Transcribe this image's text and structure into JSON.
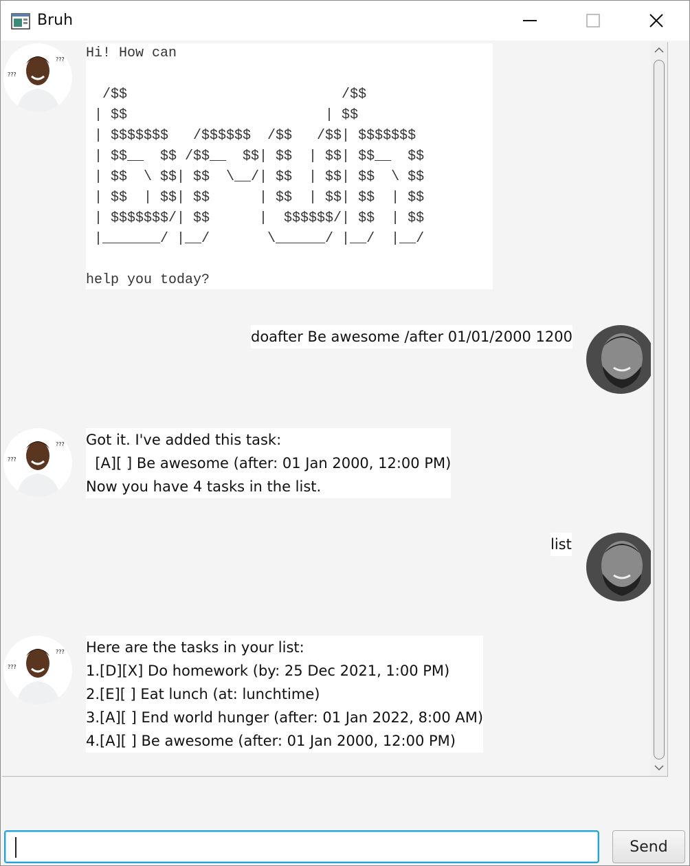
{
  "window": {
    "title": "Bruh",
    "controls": [
      "minimize",
      "maximize",
      "close"
    ]
  },
  "messages": [
    {
      "sender": "bot",
      "style": "mono",
      "text": "Hi! How can\n\n  /$$                          /$$\n | $$                        | $$\n | $$$$$$$   /$$$$$$  /$$   /$$| $$$$$$$\n | $$__  $$ /$$__  $$| $$  | $$| $$__  $$\n | $$  \\ $$| $$  \\__/| $$  | $$| $$  \\ $$\n | $$  | $$| $$      | $$  | $$| $$  | $$\n | $$$$$$$/| $$      |  $$$$$$/| $$  | $$\n |_______/ |__/       \\______/ |__/  |__/\n\nhelp you today?"
    },
    {
      "sender": "user",
      "style": "sans",
      "text": "doafter Be awesome /after 01/01/2000 1200"
    },
    {
      "sender": "bot",
      "style": "sans",
      "text": "Got it. I've added this task:\n  [A][ ] Be awesome (after: 01 Jan 2000, 12:00 PM)\nNow you have 4 tasks in the list."
    },
    {
      "sender": "user",
      "style": "sans",
      "text": "list"
    },
    {
      "sender": "bot",
      "style": "sans",
      "text": "Here are the tasks in your list:\n1.[D][X] Do homework (by: 25 Dec 2021, 1:00 PM)\n2.[E][ ] Eat lunch (at: lunchtime)\n3.[A][ ] End world hunger (after: 01 Jan 2022, 8:00 AM)\n4.[A][ ] Be awesome (after: 01 Jan 2000, 12:00 PM)"
    }
  ],
  "avatar_labels": {
    "bot": "???",
    "bot_small": "???"
  },
  "input": {
    "value": "",
    "placeholder": ""
  },
  "send_button": {
    "label": "Send"
  },
  "colors": {
    "input_focus": "#2a9fd6",
    "bubble_bg": "#ffffff",
    "window_bg": "#f4f4f4"
  }
}
